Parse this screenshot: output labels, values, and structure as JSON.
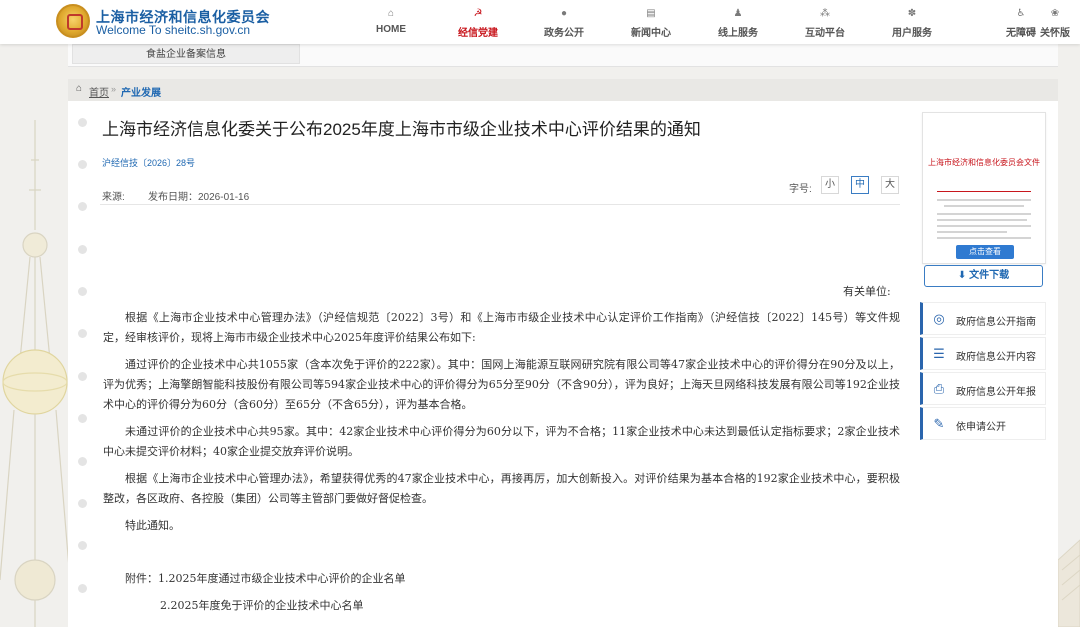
{
  "header": {
    "site_title": "上海市经济和信息化委员会",
    "site_sub": "Welcome  To  sheitc.sh.gov.cn",
    "nav": [
      {
        "label": "HOME",
        "icon": "home-icon"
      },
      {
        "label": "经信党建",
        "icon": "party-emblem-icon",
        "active": true
      },
      {
        "label": "政务公开",
        "icon": "chat-icon"
      },
      {
        "label": "新闻中心",
        "icon": "news-icon"
      },
      {
        "label": "线上服务",
        "icon": "user-service-icon"
      },
      {
        "label": "互动平台",
        "icon": "interaction-icon"
      },
      {
        "label": "用户服务",
        "icon": "user-icon"
      }
    ],
    "utils": [
      {
        "label": "无障碍",
        "icon": "accessibility-icon"
      },
      {
        "label": "关怀版",
        "icon": "care-icon"
      }
    ],
    "accent_color": "#c8161d",
    "brand_color": "#1b5fa3"
  },
  "sub_strip": {
    "tab_label": "食盐企业备案信息"
  },
  "breadcrumb": {
    "home": "首页",
    "separator": "»",
    "current": "产业发展"
  },
  "article": {
    "title": "上海市经济信息化委关于公布2025年度上海市市级企业技术中心评价结果的通知",
    "doc_number": "沪经信技〔2026〕28号",
    "source_label": "来源:",
    "date_label": "发布日期：2026-01-16",
    "font_size_label": "字号:",
    "font_small": "小",
    "font_medium": "中",
    "font_large": "大",
    "addressee": "有关单位:",
    "paragraphs": [
      "根据《上海市企业技术中心管理办法》（沪经信规范〔2022〕3号）和《上海市市级企业技术中心认定评价工作指南》（沪经信技〔2022〕145号）等文件规定，经审核评价，现将上海市市级企业技术中心2025年度评价结果公布如下:",
      "通过评价的企业技术中心共1055家（含本次免于评价的222家）。其中：国网上海能源互联网研究院有限公司等47家企业技术中心的评价得分在90分及以上，评为优秀；上海擎朗智能科技股份有限公司等594家企业技术中心的评价得分为65分至90分（不含90分），评为良好；上海天旦网络科技发展有限公司等192企业技术中心的评价得分为60分（含60分）至65分（不含65分），评为基本合格。",
      "未通过评价的企业技术中心共95家。其中：42家企业技术中心评价得分为60分以下，评为不合格；11家企业技术中心未达到最低认定指标要求；2家企业技术中心未提交评价材料；40家企业提交放弃评价说明。",
      "根据《上海市企业技术中心管理办法》，希望获得优秀的47家企业技术中心，再接再厉，加大创新投入。对评价结果为基本合格的192家企业技术中心，要积极整改，各区政府、各控股（集团）公司等主管部门要做好督促检查。",
      "特此通知。"
    ],
    "attachments": [
      "附件：1.2025年度通过市级企业技术中心评价的企业名单",
      "2.2025年度免于评价的企业技术中心名单"
    ]
  },
  "sidebar": {
    "thumb_header": "上海市经济和信息化委员会文件",
    "thumb_button": "点击查看",
    "download_label": "文件下载",
    "items": [
      {
        "label": "政府信息公开指南",
        "icon": "compass-icon"
      },
      {
        "label": "政府信息公开内容",
        "icon": "list-icon"
      },
      {
        "label": "政府信息公开年报",
        "icon": "printer-icon"
      },
      {
        "label": "依申请公开",
        "icon": "form-icon"
      }
    ]
  }
}
